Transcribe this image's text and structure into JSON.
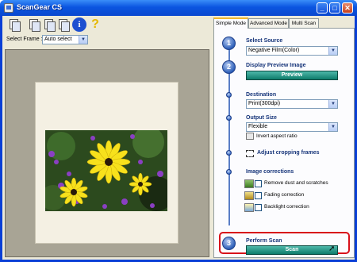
{
  "window": {
    "title": "ScanGear CS"
  },
  "titlebar_buttons": [
    "_",
    "□",
    "✕"
  ],
  "toolbar": {
    "info_glyph": "i",
    "help_glyph": "?"
  },
  "preview": {
    "select_frame_label": "Select Frame :",
    "select_frame_value": "Auto select"
  },
  "tabs": [
    {
      "label": "Simple Mode",
      "active": true
    },
    {
      "label": "Advanced Mode",
      "active": false
    },
    {
      "label": "Multi Scan",
      "active": false
    }
  ],
  "steps": {
    "select_source": {
      "number": "1",
      "title": "Select Source",
      "value": "Negative Film(Color)"
    },
    "display_preview": {
      "number": "2",
      "title": "Display Preview Image",
      "button": "Preview"
    },
    "destination": {
      "title": "Destination",
      "value": "Print(300dpi)"
    },
    "output_size": {
      "title": "Output Size",
      "value": "Flexible",
      "invert_label": "Invert aspect ratio"
    },
    "adjust_cropping": {
      "title": "Adjust cropping frames"
    },
    "image_corrections": {
      "title": "Image corrections",
      "items": [
        {
          "label": "Remove dust and scratches",
          "checked": false
        },
        {
          "label": "Fading correction",
          "checked": false
        },
        {
          "label": "Backlight correction",
          "checked": false
        }
      ]
    },
    "perform_scan": {
      "number": "3",
      "title": "Perform Scan",
      "button": "Scan"
    }
  },
  "colors": {
    "accent_teal": "#0e7c6b",
    "highlight_red": "#d8101a",
    "titlebar_blue": "#0a48cf"
  }
}
